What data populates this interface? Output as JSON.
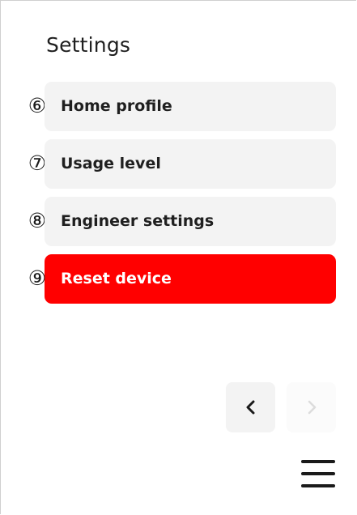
{
  "page": {
    "title": "Settings"
  },
  "menu": {
    "items": [
      {
        "callout": "⑥",
        "label": "Home profile",
        "variant": "default"
      },
      {
        "callout": "⑦",
        "label": "Usage level",
        "variant": "default"
      },
      {
        "callout": "⑧",
        "label": "Engineer settings",
        "variant": "default"
      },
      {
        "callout": "⑨",
        "label": "Reset device",
        "variant": "danger"
      }
    ]
  },
  "pagination": {
    "prev_icon": "chevron-left-icon",
    "next_icon": "chevron-right-icon",
    "next_enabled": false
  },
  "footer": {
    "menu_icon": "hamburger-menu-icon"
  },
  "colors": {
    "item_background": "#f3f3f3",
    "danger_background": "#ff0000",
    "text": "#1f1f1f",
    "disabled_icon": "#dcdcdc"
  }
}
